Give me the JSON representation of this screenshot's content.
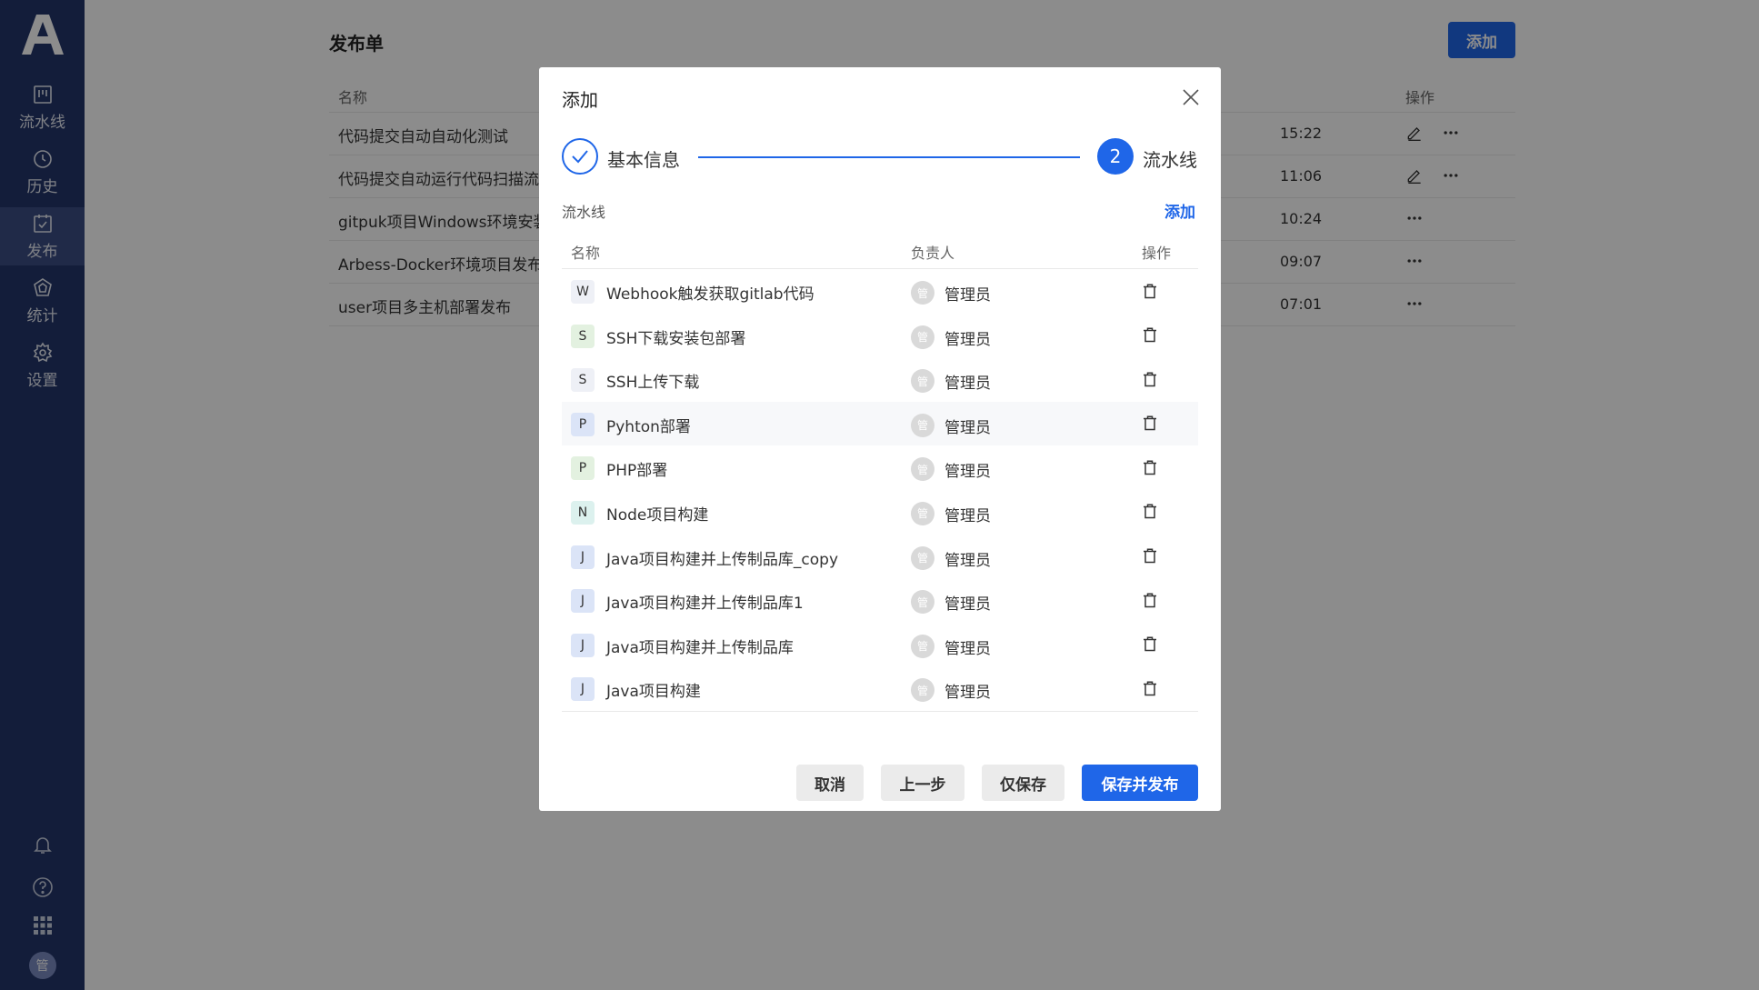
{
  "sidebar": {
    "logo": "A",
    "items": [
      {
        "label": "流水线",
        "icon": "pipeline-icon"
      },
      {
        "label": "历史",
        "icon": "clock-icon"
      },
      {
        "label": "发布",
        "icon": "release-icon"
      },
      {
        "label": "统计",
        "icon": "stats-icon"
      },
      {
        "label": "设置",
        "icon": "gear-icon"
      }
    ],
    "active_index": 2,
    "avatar": "管"
  },
  "page": {
    "title": "发布单",
    "add_label": "添加",
    "columns": [
      "名称",
      "操作"
    ],
    "rows": [
      {
        "name": "代码提交自动自动化测试",
        "time": "15:22",
        "editable": true
      },
      {
        "name": "代码提交自动运行代码扫描流",
        "time": "11:06",
        "editable": true
      },
      {
        "name": "gitpuk项目Windows环境安装",
        "time": "10:24",
        "editable": false
      },
      {
        "name": "Arbess-Docker环境项目发布",
        "time": "09:07",
        "editable": false
      },
      {
        "name": "user项目多主机部署发布",
        "time": "07:01",
        "editable": false
      }
    ]
  },
  "modal": {
    "title": "添加",
    "steps": [
      {
        "label": "基本信息",
        "state": "done"
      },
      {
        "label": "流水线",
        "number": "2",
        "state": "active"
      }
    ],
    "section_label": "流水线",
    "section_add": "添加",
    "columns": {
      "name": "名称",
      "owner": "负责人",
      "action": "操作"
    },
    "rows": [
      {
        "initial": "W",
        "name": "Webhook触发获取gitlab代码",
        "owner": "管理员",
        "avatar": "管",
        "badge_color": "#eef0f6"
      },
      {
        "initial": "S",
        "name": "SSH下载安装包部署",
        "owner": "管理员",
        "avatar": "管",
        "badge_color": "#e3f1e0"
      },
      {
        "initial": "S",
        "name": "SSH上传下载",
        "owner": "管理员",
        "avatar": "管",
        "badge_color": "#eef0f6"
      },
      {
        "initial": "P",
        "name": "Pyhton部署",
        "owner": "管理员",
        "avatar": "管",
        "badge_color": "#dbe4f7"
      },
      {
        "initial": "P",
        "name": "PHP部署",
        "owner": "管理员",
        "avatar": "管",
        "badge_color": "#e3f1e0"
      },
      {
        "initial": "N",
        "name": "Node项目构建",
        "owner": "管理员",
        "avatar": "管",
        "badge_color": "#dcf1ee"
      },
      {
        "initial": "J",
        "name": "Java项目构建并上传制品库_copy",
        "owner": "管理员",
        "avatar": "管",
        "badge_color": "#dbe4f7"
      },
      {
        "initial": "J",
        "name": "Java项目构建并上传制品库1",
        "owner": "管理员",
        "avatar": "管",
        "badge_color": "#dbe4f7"
      },
      {
        "initial": "J",
        "name": "Java项目构建并上传制品库",
        "owner": "管理员",
        "avatar": "管",
        "badge_color": "#dbe4f7"
      },
      {
        "initial": "J",
        "name": "Java项目构建",
        "owner": "管理员",
        "avatar": "管",
        "badge_color": "#dbe4f7"
      }
    ],
    "highlight_index": 3,
    "buttons": {
      "cancel": "取消",
      "prev": "上一步",
      "save": "仅保存",
      "save_publish": "保存并发布"
    }
  },
  "colors": {
    "primary": "#1f66e8",
    "sidebar": "#23356b"
  }
}
